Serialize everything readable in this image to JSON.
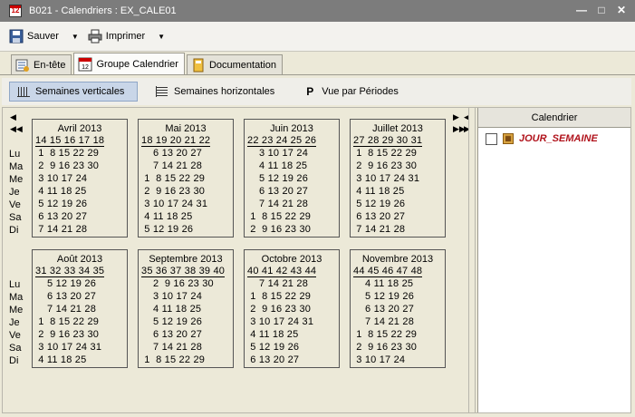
{
  "window": {
    "title": "B021 - Calendriers : EX_CALE01"
  },
  "toolbar": {
    "save_label": "Sauver",
    "print_label": "Imprimer"
  },
  "tabs": [
    {
      "label": "En-tête"
    },
    {
      "label": "Groupe Calendrier"
    },
    {
      "label": "Documentation"
    }
  ],
  "views": [
    {
      "label": "Semaines verticales"
    },
    {
      "label": "Semaines horizontales"
    },
    {
      "label": "Vue par Périodes",
      "prefix": "P"
    }
  ],
  "days": [
    "Lu",
    "Ma",
    "Me",
    "Je",
    "Ve",
    "Sa",
    "Di"
  ],
  "months": [
    {
      "name": "Avril  2013",
      "weeks": "14 15 16 17 18",
      "rows": [
        " 1  8 15 22 29",
        " 2  9 16 23 30",
        " 3 10 17 24",
        " 4 11 18 25",
        " 5 12 19 26",
        " 6 13 20 27",
        " 7 14 21 28"
      ]
    },
    {
      "name": "Mai  2013",
      "weeks": "18 19 20 21 22",
      "rows": [
        "    6 13 20 27",
        "    7 14 21 28",
        " 1  8 15 22 29",
        " 2  9 16 23 30",
        " 3 10 17 24 31",
        " 4 11 18 25",
        " 5 12 19 26"
      ]
    },
    {
      "name": "Juin  2013",
      "weeks": "22 23 24 25 26",
      "rows": [
        "    3 10 17 24",
        "    4 11 18 25",
        "    5 12 19 26",
        "    6 13 20 27",
        "    7 14 21 28",
        " 1  8 15 22 29",
        " 2  9 16 23 30"
      ]
    },
    {
      "name": "Juillet  2013",
      "weeks": "27 28 29 30 31",
      "rows": [
        " 1  8 15 22 29",
        " 2  9 16 23 30",
        " 3 10 17 24 31",
        " 4 11 18 25",
        " 5 12 19 26",
        " 6 13 20 27",
        " 7 14 21 28"
      ]
    },
    {
      "name": "Août  2013",
      "weeks": "31 32 33 34 35",
      "rows": [
        "    5 12 19 26",
        "    6 13 20 27",
        "    7 14 21 28",
        " 1  8 15 22 29",
        " 2  9 16 23 30",
        " 3 10 17 24 31",
        " 4 11 18 25"
      ]
    },
    {
      "name": "Septembre  2013",
      "weeks": "35 36 37 38 39 40",
      "rows": [
        "    2  9 16 23 30",
        "    3 10 17 24",
        "    4 11 18 25",
        "    5 12 19 26",
        "    6 13 20 27",
        "    7 14 21 28",
        " 1  8 15 22 29"
      ]
    },
    {
      "name": "Octobre  2013",
      "weeks": "40 41 42 43 44",
      "rows": [
        "    7 14 21 28",
        " 1  8 15 22 29",
        " 2  9 16 23 30",
        " 3 10 17 24 31",
        " 4 11 18 25",
        " 5 12 19 26",
        " 6 13 20 27"
      ]
    },
    {
      "name": "Novembre  2013",
      "weeks": "44 45 46 47 48",
      "rows": [
        "    4 11 18 25",
        "    5 12 19 26",
        "    6 13 20 27",
        "    7 14 21 28",
        " 1  8 15 22 29",
        " 2  9 16 23 30",
        " 3 10 17 24"
      ]
    }
  ],
  "right_panel": {
    "header": "Calendrier",
    "items": [
      {
        "label": "JOUR_SEMAINE",
        "checked": false
      }
    ]
  },
  "colors": {
    "title_bar": "#7c7c7c",
    "active_view": "#c9d6e8",
    "calendar_label": "#b0121b"
  }
}
